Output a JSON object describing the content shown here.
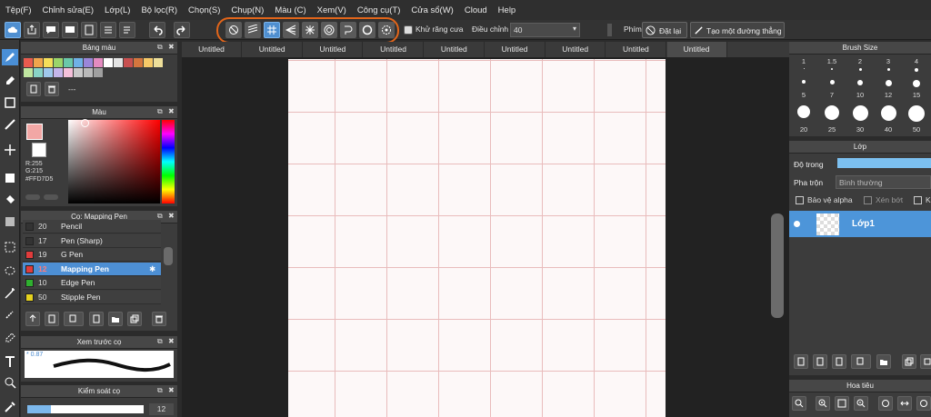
{
  "menu": [
    "Tệp(F)",
    "Chỉnh sửa(E)",
    "Lớp(L)",
    "Bộ lọc(R)",
    "Chọn(S)",
    "Chụp(N)",
    "Màu (C)",
    "Xem(V)",
    "Công cụ(T)",
    "Cửa sổ(W)",
    "Cloud",
    "Help"
  ],
  "toolbar": {
    "antialias_label": "Khử răng cưa",
    "adjust_label": "Điều chỉnh",
    "adjust_value": "40",
    "brush_label": "Phím",
    "reset_label": "Đặt lại",
    "line_label": "Tạo một đường thẳng"
  },
  "palette": {
    "title": "Bảng màu",
    "value": "---",
    "swatches": [
      "#e85b4e",
      "#f0a54c",
      "#f4df5a",
      "#9ad56a",
      "#6ac8a9",
      "#6fb1e6",
      "#9a86d9",
      "#e48bc0",
      "#ffffff",
      "#e4e4e4",
      "#c85050",
      "#d4763e",
      "#f6c968",
      "#eedf9a",
      "#bfe6a0",
      "#88d3c6",
      "#9fc8ec",
      "#c4b5ea",
      "#f4c0da",
      "#c9c9c9",
      "#bababa",
      "#a0a0a0"
    ]
  },
  "color": {
    "title": "Màu",
    "r": "R:255",
    "g": "G:215",
    "hex": "#FFD7D5",
    "fg": "#f2a7a5"
  },
  "brushes": {
    "title": "Cọ: Mapping Pen",
    "items": [
      {
        "num": "20",
        "name": "Pencil",
        "color": "#333333"
      },
      {
        "num": "17",
        "name": "Pen (Sharp)",
        "color": "#333333"
      },
      {
        "num": "19",
        "name": "G Pen",
        "color": "#e03c3c"
      },
      {
        "num": "12",
        "name": "Mapping Pen",
        "color": "#e03c3c"
      },
      {
        "num": "10",
        "name": "Edge Pen",
        "color": "#2fb02f"
      },
      {
        "num": "50",
        "name": "Stipple Pen",
        "color": "#e6d21e"
      }
    ]
  },
  "preview": {
    "title": "Xem trước cọ",
    "size": "* 0.87"
  },
  "control": {
    "title": "Kiểm soát cọ",
    "value": "12"
  },
  "tabs": [
    "Untitled",
    "Untitled",
    "Untitled",
    "Untitled",
    "Untitled",
    "Untitled",
    "Untitled",
    "Untitled",
    "Untitled"
  ],
  "brush_size": {
    "title": "Brush Size",
    "row1": [
      "1",
      "1.5",
      "2",
      "3",
      "4"
    ],
    "row2": [
      "5",
      "7",
      "10",
      "12",
      "15"
    ],
    "row3": [
      "20",
      "25",
      "30",
      "40",
      "50"
    ]
  },
  "layer": {
    "title": "Lớp",
    "opacity_label": "Độ trong",
    "blend_label": "Pha trộn",
    "blend_value": "Bình thường",
    "protect_alpha": "Bảo vệ alpha",
    "clip": "Xén bớt",
    "lock_tail": "K",
    "layer_name": "Lớp1"
  },
  "navigator": {
    "title": "Hoa tiêu"
  }
}
